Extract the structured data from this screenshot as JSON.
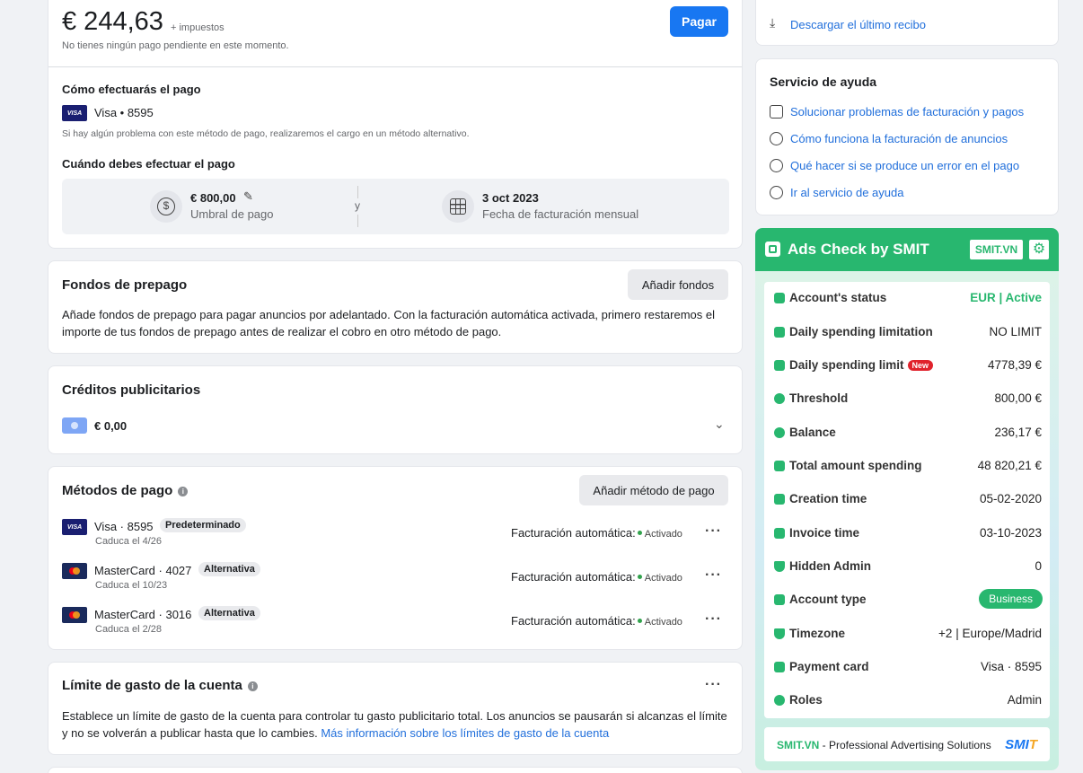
{
  "summary": {
    "amount": "€ 244,63",
    "tax_note": "+ impuestos",
    "no_pending": "No tienes ningún pago pendiente en este momento.",
    "pay_button": "Pagar",
    "how_pay_title": "Cómo efectuarás el pago",
    "card_brand": "VISA",
    "card_label": "Visa • 8595",
    "fallback_note": "Si hay algún problema con este método de pago, realizaremos el cargo en un método alternativo.",
    "when_pay_title": "Cuándo debes efectuar el pago",
    "threshold_value": "€ 800,00",
    "threshold_label": "Umbral de pago",
    "and": "y",
    "billing_date": "3 oct 2023",
    "billing_date_label": "Fecha de facturación mensual"
  },
  "prepay": {
    "title": "Fondos de prepago",
    "button": "Añadir fondos",
    "text": "Añade fondos de prepago para pagar anuncios por adelantado. Con la facturación automática activada, primero restaremos el importe de tus fondos de prepago antes de realizar el cobro en otro método de pago."
  },
  "credits": {
    "title": "Créditos publicitarios",
    "amount": "€ 0,00"
  },
  "methods": {
    "title": "Métodos de pago",
    "button": "Añadir método de pago",
    "auto_label": "Facturación automática:",
    "items": [
      {
        "name": "Visa · 8595",
        "tag": "Predeterminado",
        "expiry": "Caduca el 4/26",
        "status": "Activado"
      },
      {
        "name": "MasterCard · 4027",
        "tag": "Alternativa",
        "expiry": "Caduca el 10/23",
        "status": "Activado"
      },
      {
        "name": "MasterCard · 3016",
        "tag": "Alternativa",
        "expiry": "Caduca el 2/28",
        "status": "Activado"
      }
    ]
  },
  "limit": {
    "title": "Límite de gasto de la cuenta",
    "text": "Establece un límite de gasto de la cuenta para controlar tu gasto publicitario total. Los anuncios se pausarán si alcanzas el límite y no se volverán a publicar hasta que lo cambies. ",
    "link": "Más información sobre los límites de gasto de la cuenta"
  },
  "receipt": {
    "link": "Descargar el último recibo"
  },
  "help": {
    "title": "Servicio de ayuda",
    "links": [
      "Solucionar problemas de facturación y pagos",
      "Cómo funciona la facturación de anuncios",
      "Qué hacer si se produce un error en el pago",
      "Ir al servicio de ayuda"
    ]
  },
  "smit": {
    "title": "Ads Check by SMIT",
    "badge": "SMIT.VN",
    "new_badge": "New",
    "rows": [
      {
        "label": "Account's status",
        "value": "EUR | Active"
      },
      {
        "label": "Daily spending limitation",
        "value": "NO LIMIT"
      },
      {
        "label": "Daily spending limit",
        "value": "4778,39 €"
      },
      {
        "label": "Threshold",
        "value": "800,00 €"
      },
      {
        "label": "Balance",
        "value": "236,17 €"
      },
      {
        "label": "Total amount spending",
        "value": "48 820,21 €"
      },
      {
        "label": "Creation time",
        "value": "05-02-2020"
      },
      {
        "label": "Invoice time",
        "value": "03-10-2023"
      },
      {
        "label": "Hidden Admin",
        "value": "0"
      },
      {
        "label": "Account type",
        "value": "Business"
      },
      {
        "label": "Timezone",
        "value": "+2 | Europe/Madrid"
      },
      {
        "label": "Payment card",
        "value": "Visa · 8595"
      },
      {
        "label": "Roles",
        "value": "Admin"
      }
    ],
    "footer_brand": "SMIT.VN",
    "footer_text": " - Professional Advertising Solutions",
    "footer_logo_a": "SMI",
    "footer_logo_b": "T"
  },
  "colors": {
    "accent": "#1877f2",
    "smit_green": "#28b76f",
    "link": "#216fdb",
    "new_red": "#e0232c"
  }
}
